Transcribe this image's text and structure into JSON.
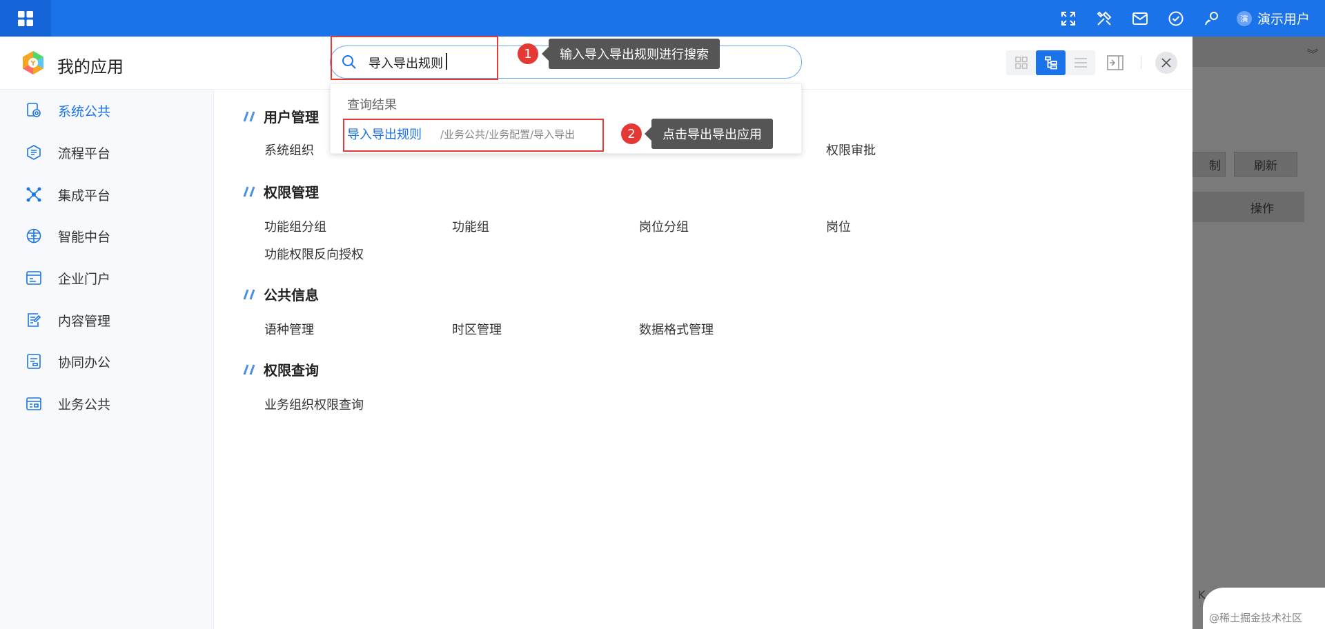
{
  "topbar": {
    "user_avatar": "演",
    "user_name": "演示用户"
  },
  "background_page": {
    "copy_label": "制",
    "refresh_label": "刷新",
    "table_header": "操作",
    "footer_text": "K"
  },
  "panel": {
    "title": "我的应用"
  },
  "search": {
    "value": "导入导出规则",
    "results_heading": "查询结果",
    "result_label": "导入导出规则",
    "result_path": "/业务公共/业务配置/导入导出"
  },
  "annotations": {
    "step1_number": "1",
    "step1_text": "输入导入导出规则进行搜索",
    "step2_number": "2",
    "step2_text": "点击导出导出应用"
  },
  "sidebar": {
    "items": [
      {
        "label": "系统公共",
        "icon": "settings-gear-icon",
        "active": true
      },
      {
        "label": "流程平台",
        "icon": "process-icon",
        "active": false
      },
      {
        "label": "集成平台",
        "icon": "integration-icon",
        "active": false
      },
      {
        "label": "智能中台",
        "icon": "intelligence-icon",
        "active": false
      },
      {
        "label": "企业门户",
        "icon": "portal-icon",
        "active": false
      },
      {
        "label": "内容管理",
        "icon": "content-edit-icon",
        "active": false
      },
      {
        "label": "协同办公",
        "icon": "office-doc-icon",
        "active": false
      },
      {
        "label": "业务公共",
        "icon": "business-icon",
        "active": false
      }
    ]
  },
  "sections": [
    {
      "title": "用户管理",
      "links": [
        "系统组织",
        "权限审批"
      ]
    },
    {
      "title": "权限管理",
      "links": [
        "功能组分组",
        "功能组",
        "岗位分组",
        "岗位",
        "功能权限反向授权"
      ]
    },
    {
      "title": "公共信息",
      "links": [
        "语种管理",
        "时区管理",
        "数据格式管理"
      ]
    },
    {
      "title": "权限查询",
      "links": [
        "业务组织权限查询"
      ]
    }
  ],
  "watermark": {
    "text": "@稀土掘金技术社区"
  },
  "colors": {
    "primary": "#1a73e8",
    "annotation_red": "#e53935",
    "tooltip_bg": "#555555"
  }
}
